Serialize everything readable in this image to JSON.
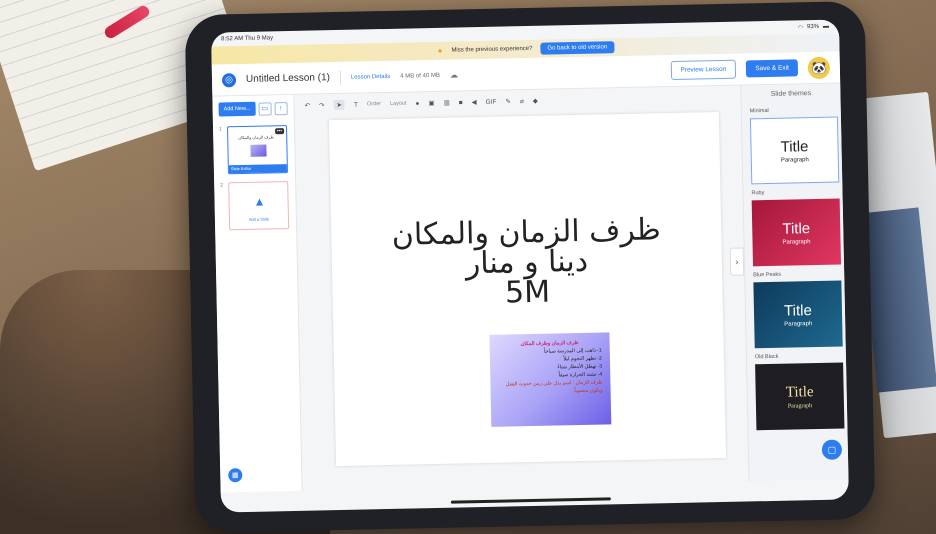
{
  "statusbar": {
    "time": "8:52 AM  Thu 9 May",
    "battery": "93%"
  },
  "notice": {
    "text": "Miss the previous experience?",
    "button": "Go back to old version"
  },
  "header": {
    "lesson_title": "Untitled Lesson (1)",
    "details_label": "Lesson Details",
    "storage": "4 MB of 40 MB",
    "preview_label": "Preview Lesson",
    "save_label": "Save & Exit"
  },
  "toolbar": {
    "order": "Order",
    "layout": "Layout",
    "gif": "GIF",
    "text_tool": "T"
  },
  "sidebar": {
    "add_new": "Add New...",
    "slides": [
      {
        "number": "1",
        "caption": "Slide Editor",
        "thumb_text": "ظرف الزمان والمكان"
      },
      {
        "number": "2",
        "caption": "Add a Slide"
      }
    ]
  },
  "slide": {
    "line1": "ظرف الزمان والمكان",
    "line2": "دينا و منار",
    "line3": "5M",
    "image": {
      "heading": "ظرف الزمان وظرف المكان",
      "lines": [
        "1- ذاهب إلى المدرسة صباحاً",
        "2- تظهر النجوم ليلاً",
        "3- تهطل الأمطار شتاءً",
        "4- تشتد الحرارة صيفاً"
      ],
      "footer": "ظرف الزمان : اسم يدل على زمن حدوث الفعل ويكون منصوباً."
    }
  },
  "themes_panel": {
    "title": "Slide themes",
    "themes": [
      {
        "name": "Minimal",
        "title": "Title",
        "paragraph": "Paragraph"
      },
      {
        "name": "Ruby",
        "title": "Title",
        "paragraph": "Paragraph"
      },
      {
        "name": "Blue Peaks",
        "title": "Title",
        "paragraph": "Paragraph"
      },
      {
        "name": "Old Black",
        "title": "Title",
        "paragraph": "Paragraph"
      }
    ]
  },
  "colors": {
    "accent": "#2d7cf0",
    "ruby": "#c72a4f",
    "blue_peaks": "#145073",
    "old_black": "#1d1d22"
  }
}
